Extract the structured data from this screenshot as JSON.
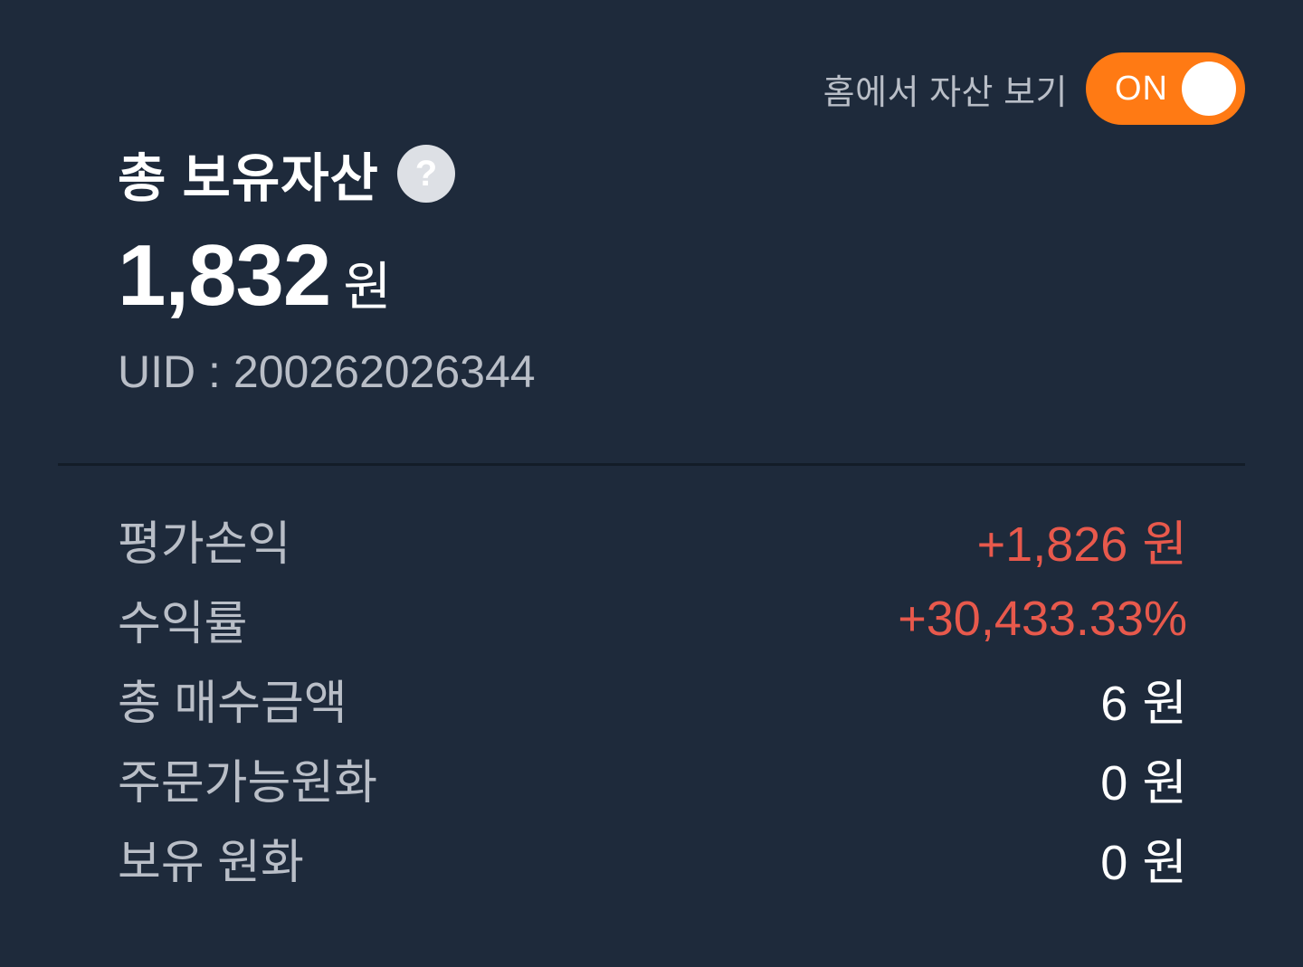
{
  "toggle": {
    "label": "홈에서 자산 보기",
    "state_text": "ON",
    "color": "#ff7a14"
  },
  "header": {
    "title": "총 보유자산",
    "help_icon": "?"
  },
  "total": {
    "amount": "1,832",
    "unit": "원"
  },
  "uid": {
    "label": "UID :",
    "value": "200262026344"
  },
  "stats": [
    {
      "label": "평가손익",
      "value": "+1,826",
      "unit": "원",
      "color": "#e8594c"
    },
    {
      "label": "수익률",
      "value": "+30,433.33%",
      "unit": "",
      "color": "#e8594c"
    },
    {
      "label": "총 매수금액",
      "value": "6",
      "unit": "원",
      "color": "#ffffff"
    },
    {
      "label": "주문가능원화",
      "value": "0",
      "unit": "원",
      "color": "#ffffff"
    },
    {
      "label": "보유 원화",
      "value": "0",
      "unit": "원",
      "color": "#ffffff"
    }
  ]
}
